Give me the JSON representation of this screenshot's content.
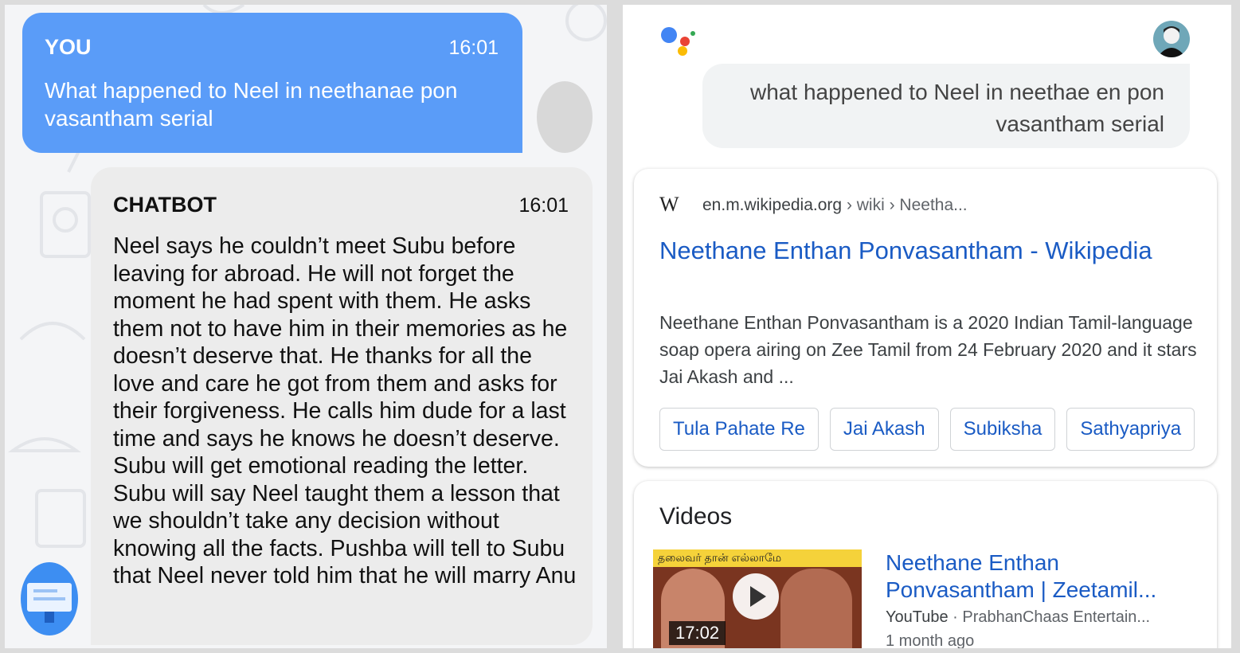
{
  "chat": {
    "user_bubble": {
      "sender": "YOU",
      "time": "16:01",
      "message": "What happened to Neel in neethanae pon vasantham serial"
    },
    "bot_bubble": {
      "sender": "CHATBOT",
      "time": "16:01",
      "message": "Neel says he couldn’t meet Subu before leaving for abroad. He will not forget the moment he had spent with them. He asks them not to have him in their memories as he doesn’t deserve that. He thanks for all the love and care he got from them and asks for their forgiveness. He calls him dude for a last time and says he knows he doesn’t deserve. Subu will get emotional reading the letter. Subu will say Neel taught them a lesson that we shouldn’t take any decision without knowing all the facts. Pushba will tell to Subu that Neel never told him that he will marry Anu"
    },
    "colors": {
      "user_bubble": "#5a9cf8",
      "bot_bubble": "#ececec"
    }
  },
  "assistant": {
    "query": "what happened to Neel in neethae en pon vasantham serial",
    "result": {
      "site_icon": "W",
      "site": "en.m.wikipedia.org",
      "breadcrumb": "› wiki › Neetha...",
      "title": "Neethane Enthan Ponvasantham - Wikipedia",
      "snippet": "Neethane Enthan Ponvasantham is a 2020 Indian Tamil-language soap opera airing on Zee Tamil from 24 February 2020 and it stars Jai Akash and ...",
      "chips": [
        "Tula Pahate Re",
        "Jai Akash",
        "Subiksha",
        "Sathyapriya"
      ]
    },
    "videos": {
      "heading": "Videos",
      "items": [
        {
          "title": "Neethane Enthan Ponvasantham | Zeetamil...",
          "source": "YouTube",
          "channel": "· PrabhanChaas Entertain...",
          "age": "1 month ago",
          "duration": "17:02",
          "thumb_text": "தலைவர் தான் எல்லாமே"
        }
      ]
    },
    "colors": {
      "link": "#1a5bc4"
    }
  }
}
